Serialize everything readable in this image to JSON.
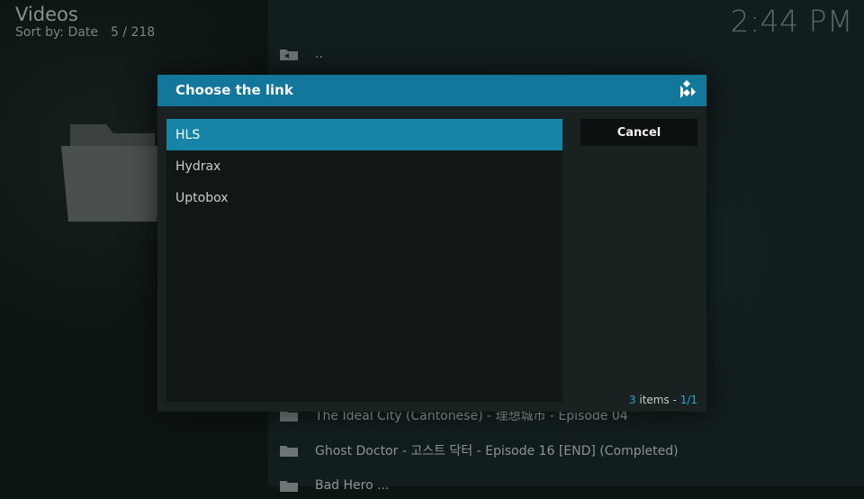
{
  "header": {
    "title": "Videos",
    "sort_label": "Sort by: Date",
    "position": "5 / 218"
  },
  "clock": "2:44 PM",
  "background_list": {
    "items": [
      {
        "label": ".."
      },
      {
        "label": "The Ideal City (Cantonese) - 理想城市 - Episode 04"
      },
      {
        "label": "Ghost Doctor - 고스트 닥터 - Episode 16 [END] (Completed)"
      },
      {
        "label": "Bad Hero ..."
      }
    ]
  },
  "dialog": {
    "title": "Choose the link",
    "cancel_label": "Cancel",
    "items": [
      {
        "label": "HLS",
        "selected": true
      },
      {
        "label": "Hydrax",
        "selected": false
      },
      {
        "label": "Uptobox",
        "selected": false
      }
    ],
    "count_number": "3",
    "count_word": " items - ",
    "page": "1/1"
  },
  "colors": {
    "accent": "#12779a",
    "selected": "#1584a7",
    "count_accent": "#2aa7d4"
  },
  "icons": {
    "logo": "kodi-logo-icon",
    "folder": "folder-icon",
    "up": "parent-folder-icon"
  }
}
